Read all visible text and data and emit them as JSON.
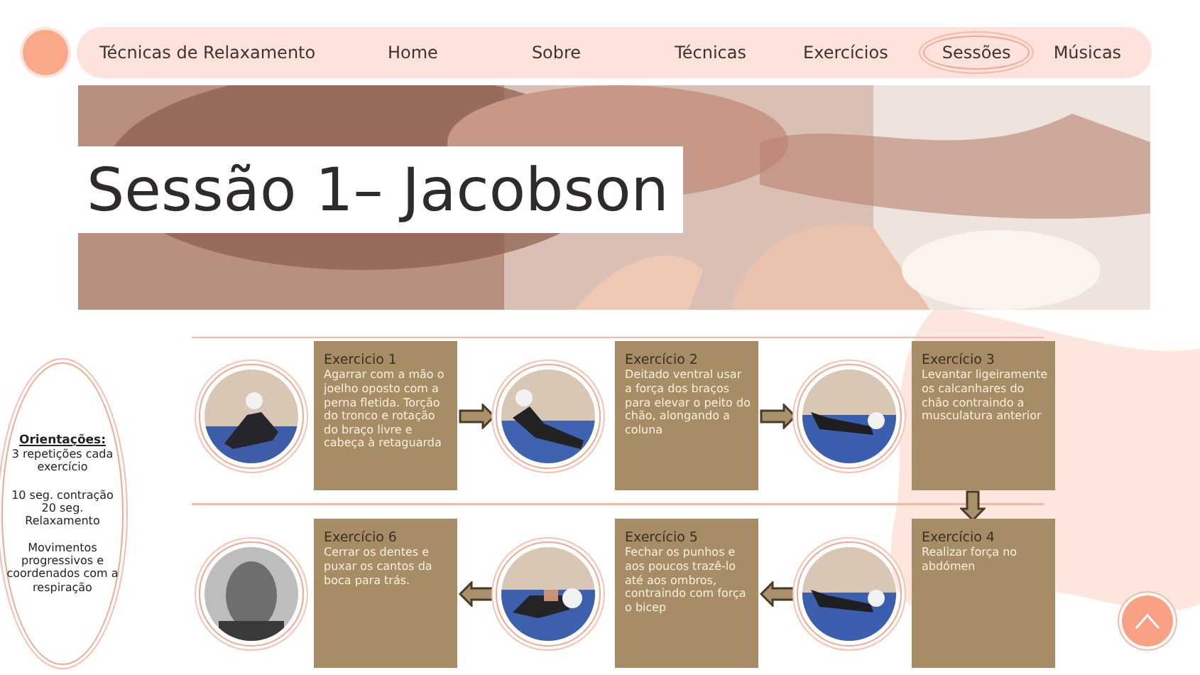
{
  "nav": {
    "brand": "Técnicas de Relaxamento",
    "items": [
      {
        "label": "Home",
        "selected": false
      },
      {
        "label": "Sobre",
        "selected": false
      },
      {
        "label": "Técnicas",
        "selected": false
      },
      {
        "label": "Exercícios",
        "selected": false
      },
      {
        "label": "Sessões",
        "selected": true
      },
      {
        "label": "Músicas",
        "selected": false
      }
    ]
  },
  "hero": {
    "title": "Sessão 1– Jacobson"
  },
  "orientations": {
    "heading": "Orientações:",
    "paragraphs": [
      "3 repetições cada exercício",
      "10 seg. contração 20 seg. Relaxamento",
      "Movimentos progressivos e coordenados com a respiração"
    ]
  },
  "rows": [
    {
      "cells": [
        {
          "kind": "picture"
        },
        {
          "kind": "card",
          "title": "Exercicio 1",
          "text": "Agarrar com a mão o joelho oposto com a perna fletida. Torção do tronco e rotação do braço livre e cabeça à retaguarda"
        },
        {
          "kind": "right-arrow"
        },
        {
          "kind": "picture"
        },
        {
          "kind": "card",
          "title": "Exercício 2",
          "text": "Deitado ventral usar a força dos braços para elevar o peito do chão, alongando a coluna"
        },
        {
          "kind": "right-arrow"
        },
        {
          "kind": "picture"
        },
        {
          "kind": "card",
          "title": "Exercício 3",
          "text": "Levantar ligeiramente os calcanhares do chão contraindo a musculatura anterior"
        }
      ]
    },
    {
      "cells": [
        {
          "kind": "picture"
        },
        {
          "kind": "card",
          "title": "Exercício 6",
          "text": "Cerrar os dentes e puxar os cantos da boca para trás."
        },
        {
          "kind": "left-arrow"
        },
        {
          "kind": "picture"
        },
        {
          "kind": "card",
          "title": "Exercício 5",
          "text": "Fechar os punhos e aos poucos trazê-lo até aos ombros, contraindo com força o bicep"
        },
        {
          "kind": "left-arrow"
        },
        {
          "kind": "picture"
        },
        {
          "kind": "card",
          "title": "Exercício 4",
          "text": "Realizar força no abdómen"
        }
      ]
    }
  ],
  "connector": {
    "kind": "down-arrow"
  }
}
